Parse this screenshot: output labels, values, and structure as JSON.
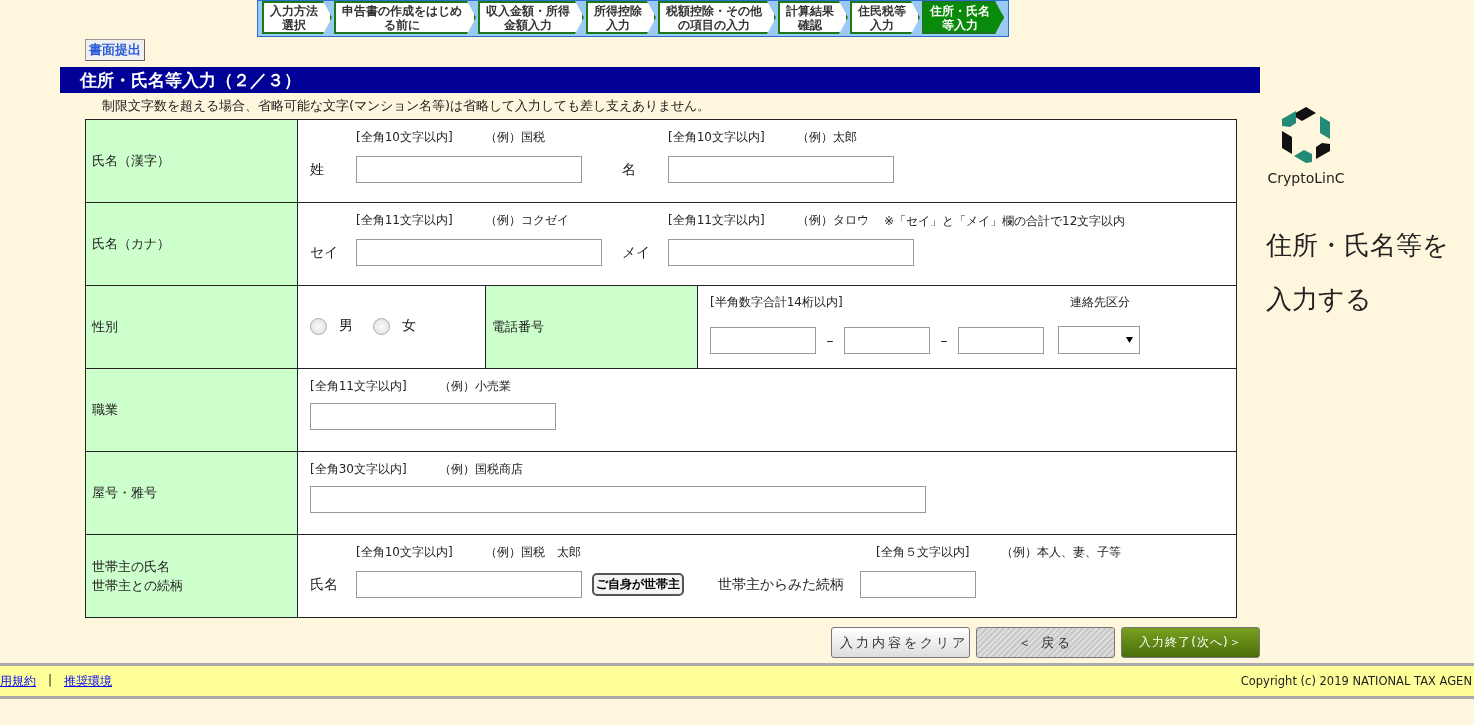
{
  "steps": [
    {
      "lines": [
        "入力方法",
        "選択"
      ],
      "selected": false
    },
    {
      "lines": [
        "申告書の作成をはじめ",
        "る前に"
      ],
      "selected": false
    },
    {
      "lines": [
        "収入金額・所得",
        "金額入力"
      ],
      "selected": false
    },
    {
      "lines": [
        "所得控除",
        "入力"
      ],
      "selected": false
    },
    {
      "lines": [
        "税額控除・その他",
        "の項目の入力"
      ],
      "selected": false
    },
    {
      "lines": [
        "計算結果",
        "確認"
      ],
      "selected": false
    },
    {
      "lines": [
        "住民税等",
        "入力"
      ],
      "selected": false
    },
    {
      "lines": [
        "住所・氏名",
        "等入力"
      ],
      "selected": true
    }
  ],
  "paper_button": "書面提出",
  "section_title": "住所・氏名等入力（２／３）",
  "note": "制限文字数を超える場合、省略可能な文字(マンション名等)は省略して入力しても差し支えありません。",
  "rows": [
    {
      "kind": "pair",
      "label": "氏名（漢字）",
      "fields": [
        {
          "hint": "[全角10文字以内]",
          "example": "（例）国税",
          "label": "姓"
        },
        {
          "hint": "[全角10文字以内]",
          "example": "（例）太郎",
          "label": "名"
        }
      ]
    },
    {
      "kind": "pair",
      "label": "氏名（カナ）",
      "fields": [
        {
          "hint": "[全角11文字以内]",
          "example": "（例）コクゼイ",
          "label": "セイ"
        },
        {
          "hint": "[全角11文字以内]",
          "example": "（例）タロウ",
          "label": "メイ"
        }
      ],
      "remark": "※「セイ」と「メイ」欄の合計で12文字以内"
    },
    {
      "kind": "gender_phone",
      "label": "性別",
      "options": [
        {
          "label": "男",
          "selected": false
        },
        {
          "label": "女",
          "selected": false
        }
      ],
      "phone_label": "電話番号",
      "phone_hint": "[半角数字合計14桁以内]",
      "dashes": [
        "–",
        "–"
      ],
      "contact_label": "連絡先区分"
    },
    {
      "kind": "single",
      "label": "職業",
      "hint": "[全角11文字以内]",
      "example": "（例）小売業",
      "wide": false
    },
    {
      "kind": "single",
      "label": "屋号・雅号",
      "hint": "[全角30文字以内]",
      "example": "（例）国税商店",
      "wide": true
    },
    {
      "kind": "householder",
      "labels": [
        "世帯主の氏名",
        "世帯主との続柄"
      ],
      "name_label": "氏名",
      "hint": "[全角10文字以内]",
      "example": "（例）国税　太郎",
      "self_button": "ご自身が世帯主",
      "relation_label": "世帯主からみた続柄",
      "relation_hint": "[全角５文字以内]",
      "relation_example": "（例）本人、妻、子等"
    }
  ],
  "buttons": [
    {
      "kind": "clear",
      "label": "入力内容をクリア"
    },
    {
      "kind": "back",
      "label": "＜ 戻る"
    },
    {
      "kind": "next",
      "label": "入力終了(次へ)＞"
    }
  ],
  "logo": {
    "name": "CryptoLinC"
  },
  "side_caption": "住所・氏名等を入力する",
  "footer": {
    "links": [
      "用規約",
      "推奨環境"
    ],
    "separator": "|",
    "copyright": "Copyright (c) 2019 NATIONAL TAX AGEN"
  }
}
